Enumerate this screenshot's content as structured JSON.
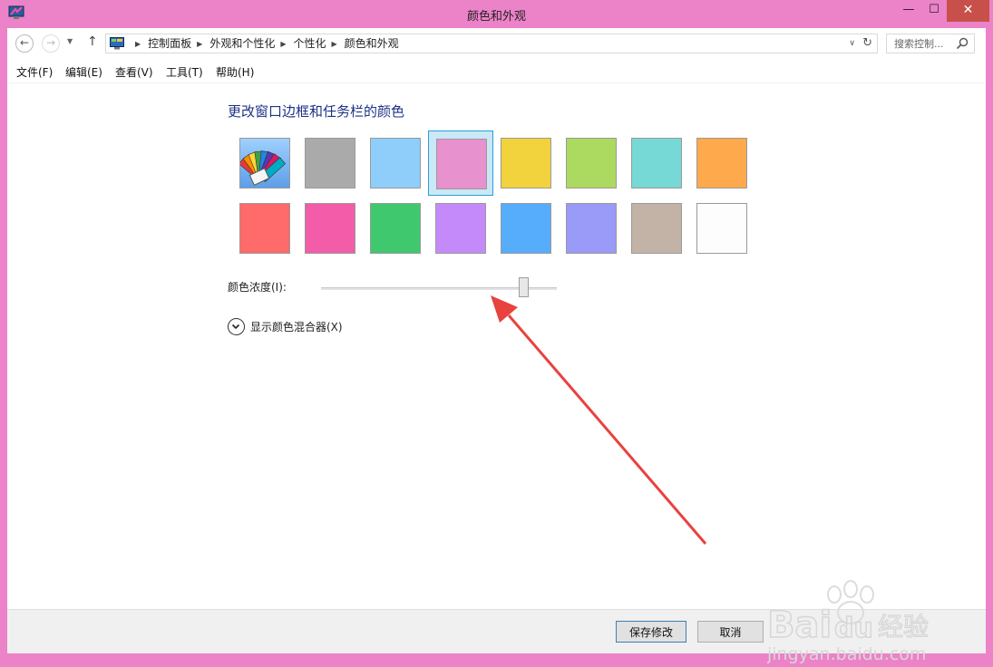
{
  "window": {
    "title": "颜色和外观",
    "minimize": "—",
    "maximize": "☐",
    "close": "✕"
  },
  "nav": {
    "back": "←",
    "forward": "→",
    "dropdown": "▼",
    "up": "↑",
    "addr_dropdown": "∨",
    "refresh": "↻"
  },
  "breadcrumb": [
    "控制面板",
    "外观和个性化",
    "个性化",
    "颜色和外观"
  ],
  "search": {
    "placeholder": "搜索控制..."
  },
  "menu": [
    "文件(F)",
    "编辑(E)",
    "查看(V)",
    "工具(T)",
    "帮助(H)"
  ],
  "heading": "更改窗口边框和任务栏的颜色",
  "swatches": {
    "icons": [
      "color-fan-icon"
    ],
    "colors": [
      "#6eaff0",
      "#aaaaaa",
      "#8fcdfb",
      "#e791cf",
      "#f2d23d",
      "#acd960",
      "#76d9d5",
      "#ffa94d",
      "#ff6a6a",
      "#f35ca8",
      "#40c86e",
      "#c58afa",
      "#55adfc",
      "#9a9af9",
      "#c3b3a6",
      "#fdfdfd"
    ],
    "selected_index": 3
  },
  "intensity": {
    "label": "颜色浓度(I):",
    "value": 0.86
  },
  "mixer": {
    "label": "显示颜色混合器(X)"
  },
  "buttons": {
    "save": "保存修改",
    "cancel": "取消"
  },
  "watermark": {
    "brand": "Bai",
    "brand2": "du",
    "suffix": "经验",
    "url": "jingyan.baidu.com"
  },
  "colors": {
    "frame": "#ec82c8",
    "heading": "#1e3287",
    "close": "#c7504a",
    "arrow": "#e8423f"
  }
}
